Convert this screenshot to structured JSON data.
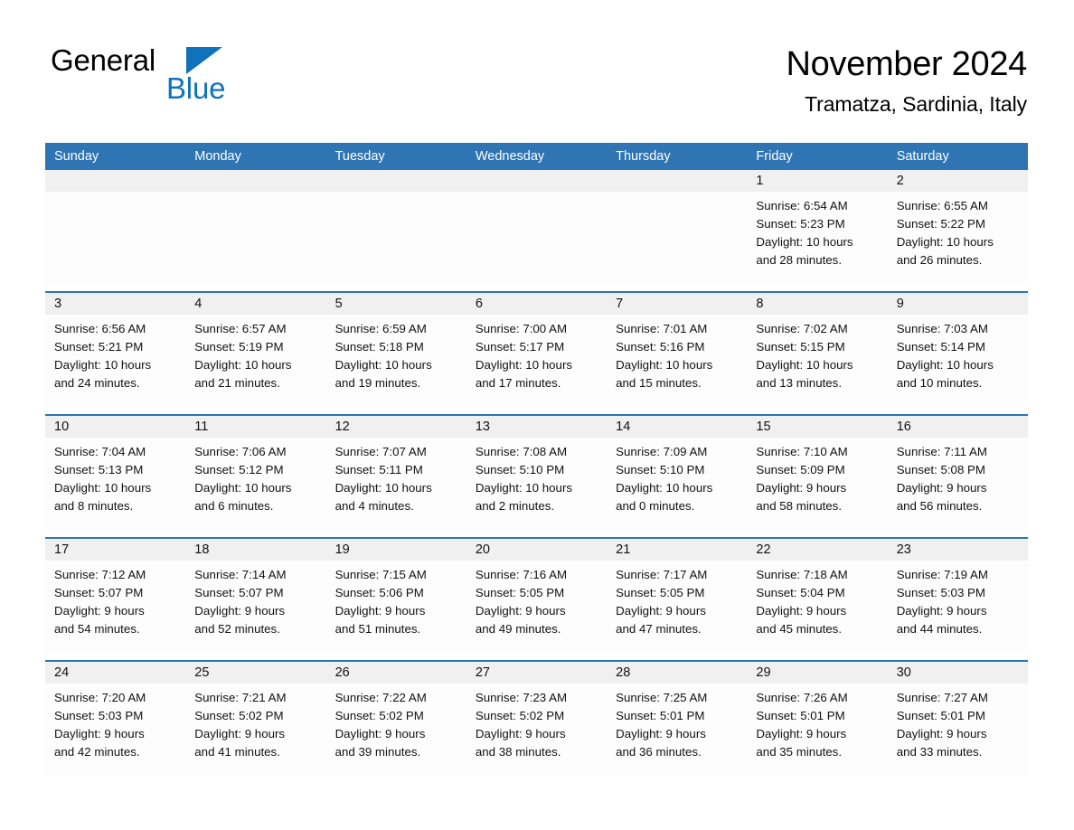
{
  "brand": {
    "name_top": "General",
    "name_bottom": "Blue",
    "triangle_icon": "brand-triangle-icon",
    "accent_color": "#1072bb"
  },
  "header": {
    "title": "November 2024",
    "subtitle": "Tramatza, Sardinia, Italy"
  },
  "calendar": {
    "header_color": "#2f74b3",
    "daynum_band_color": "#f0f0f0",
    "weekdays": [
      "Sunday",
      "Monday",
      "Tuesday",
      "Wednesday",
      "Thursday",
      "Friday",
      "Saturday"
    ],
    "weeks": [
      [
        {
          "day": "",
          "lines": []
        },
        {
          "day": "",
          "lines": []
        },
        {
          "day": "",
          "lines": []
        },
        {
          "day": "",
          "lines": []
        },
        {
          "day": "",
          "lines": []
        },
        {
          "day": "1",
          "lines": [
            "Sunrise: 6:54 AM",
            "Sunset: 5:23 PM",
            "Daylight: 10 hours",
            "and 28 minutes."
          ]
        },
        {
          "day": "2",
          "lines": [
            "Sunrise: 6:55 AM",
            "Sunset: 5:22 PM",
            "Daylight: 10 hours",
            "and 26 minutes."
          ]
        }
      ],
      [
        {
          "day": "3",
          "lines": [
            "Sunrise: 6:56 AM",
            "Sunset: 5:21 PM",
            "Daylight: 10 hours",
            "and 24 minutes."
          ]
        },
        {
          "day": "4",
          "lines": [
            "Sunrise: 6:57 AM",
            "Sunset: 5:19 PM",
            "Daylight: 10 hours",
            "and 21 minutes."
          ]
        },
        {
          "day": "5",
          "lines": [
            "Sunrise: 6:59 AM",
            "Sunset: 5:18 PM",
            "Daylight: 10 hours",
            "and 19 minutes."
          ]
        },
        {
          "day": "6",
          "lines": [
            "Sunrise: 7:00 AM",
            "Sunset: 5:17 PM",
            "Daylight: 10 hours",
            "and 17 minutes."
          ]
        },
        {
          "day": "7",
          "lines": [
            "Sunrise: 7:01 AM",
            "Sunset: 5:16 PM",
            "Daylight: 10 hours",
            "and 15 minutes."
          ]
        },
        {
          "day": "8",
          "lines": [
            "Sunrise: 7:02 AM",
            "Sunset: 5:15 PM",
            "Daylight: 10 hours",
            "and 13 minutes."
          ]
        },
        {
          "day": "9",
          "lines": [
            "Sunrise: 7:03 AM",
            "Sunset: 5:14 PM",
            "Daylight: 10 hours",
            "and 10 minutes."
          ]
        }
      ],
      [
        {
          "day": "10",
          "lines": [
            "Sunrise: 7:04 AM",
            "Sunset: 5:13 PM",
            "Daylight: 10 hours",
            "and 8 minutes."
          ]
        },
        {
          "day": "11",
          "lines": [
            "Sunrise: 7:06 AM",
            "Sunset: 5:12 PM",
            "Daylight: 10 hours",
            "and 6 minutes."
          ]
        },
        {
          "day": "12",
          "lines": [
            "Sunrise: 7:07 AM",
            "Sunset: 5:11 PM",
            "Daylight: 10 hours",
            "and 4 minutes."
          ]
        },
        {
          "day": "13",
          "lines": [
            "Sunrise: 7:08 AM",
            "Sunset: 5:10 PM",
            "Daylight: 10 hours",
            "and 2 minutes."
          ]
        },
        {
          "day": "14",
          "lines": [
            "Sunrise: 7:09 AM",
            "Sunset: 5:10 PM",
            "Daylight: 10 hours",
            "and 0 minutes."
          ]
        },
        {
          "day": "15",
          "lines": [
            "Sunrise: 7:10 AM",
            "Sunset: 5:09 PM",
            "Daylight: 9 hours",
            "and 58 minutes."
          ]
        },
        {
          "day": "16",
          "lines": [
            "Sunrise: 7:11 AM",
            "Sunset: 5:08 PM",
            "Daylight: 9 hours",
            "and 56 minutes."
          ]
        }
      ],
      [
        {
          "day": "17",
          "lines": [
            "Sunrise: 7:12 AM",
            "Sunset: 5:07 PM",
            "Daylight: 9 hours",
            "and 54 minutes."
          ]
        },
        {
          "day": "18",
          "lines": [
            "Sunrise: 7:14 AM",
            "Sunset: 5:07 PM",
            "Daylight: 9 hours",
            "and 52 minutes."
          ]
        },
        {
          "day": "19",
          "lines": [
            "Sunrise: 7:15 AM",
            "Sunset: 5:06 PM",
            "Daylight: 9 hours",
            "and 51 minutes."
          ]
        },
        {
          "day": "20",
          "lines": [
            "Sunrise: 7:16 AM",
            "Sunset: 5:05 PM",
            "Daylight: 9 hours",
            "and 49 minutes."
          ]
        },
        {
          "day": "21",
          "lines": [
            "Sunrise: 7:17 AM",
            "Sunset: 5:05 PM",
            "Daylight: 9 hours",
            "and 47 minutes."
          ]
        },
        {
          "day": "22",
          "lines": [
            "Sunrise: 7:18 AM",
            "Sunset: 5:04 PM",
            "Daylight: 9 hours",
            "and 45 minutes."
          ]
        },
        {
          "day": "23",
          "lines": [
            "Sunrise: 7:19 AM",
            "Sunset: 5:03 PM",
            "Daylight: 9 hours",
            "and 44 minutes."
          ]
        }
      ],
      [
        {
          "day": "24",
          "lines": [
            "Sunrise: 7:20 AM",
            "Sunset: 5:03 PM",
            "Daylight: 9 hours",
            "and 42 minutes."
          ]
        },
        {
          "day": "25",
          "lines": [
            "Sunrise: 7:21 AM",
            "Sunset: 5:02 PM",
            "Daylight: 9 hours",
            "and 41 minutes."
          ]
        },
        {
          "day": "26",
          "lines": [
            "Sunrise: 7:22 AM",
            "Sunset: 5:02 PM",
            "Daylight: 9 hours",
            "and 39 minutes."
          ]
        },
        {
          "day": "27",
          "lines": [
            "Sunrise: 7:23 AM",
            "Sunset: 5:02 PM",
            "Daylight: 9 hours",
            "and 38 minutes."
          ]
        },
        {
          "day": "28",
          "lines": [
            "Sunrise: 7:25 AM",
            "Sunset: 5:01 PM",
            "Daylight: 9 hours",
            "and 36 minutes."
          ]
        },
        {
          "day": "29",
          "lines": [
            "Sunrise: 7:26 AM",
            "Sunset: 5:01 PM",
            "Daylight: 9 hours",
            "and 35 minutes."
          ]
        },
        {
          "day": "30",
          "lines": [
            "Sunrise: 7:27 AM",
            "Sunset: 5:01 PM",
            "Daylight: 9 hours",
            "and 33 minutes."
          ]
        }
      ]
    ]
  }
}
